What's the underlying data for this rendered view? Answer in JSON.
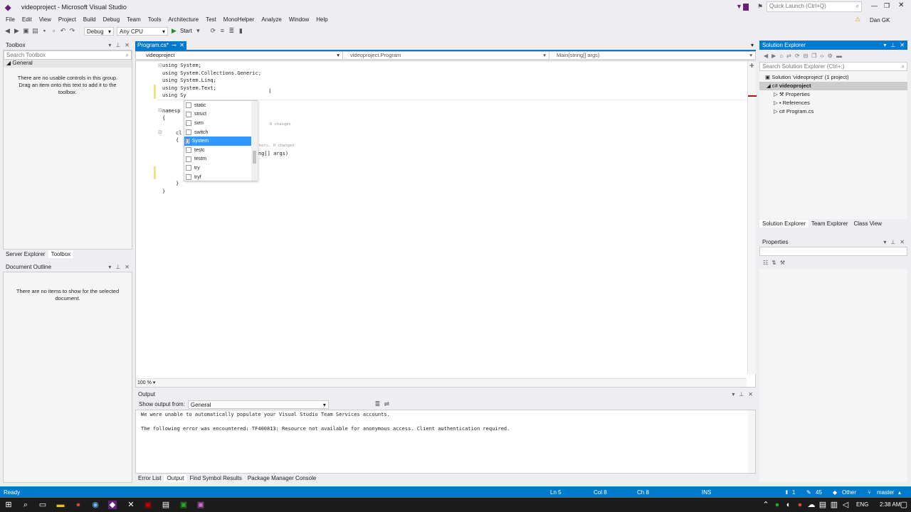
{
  "window": {
    "title": "videoproject - Microsoft Visual Studio",
    "quick_launch": "Quick Launch (Ctrl+Q)",
    "user": "Dan GK"
  },
  "menu": [
    "File",
    "Edit",
    "View",
    "Project",
    "Build",
    "Debug",
    "Team",
    "Tools",
    "Architecture",
    "Test",
    "MonoHelper",
    "Analyze",
    "Window",
    "Help"
  ],
  "toolbar": {
    "config": "Debug",
    "platform": "Any CPU",
    "start": "Start"
  },
  "toolbox": {
    "title": "Toolbox",
    "search": "Search Toolbox",
    "group": "General",
    "empty_msg": "There are no usable controls in this group. Drag an item onto this text to add it to the toolbox.",
    "tabs": [
      "Server Explorer",
      "Toolbox"
    ]
  },
  "outline": {
    "title": "Document Outline",
    "empty_msg": "There are no items to show for the selected document."
  },
  "editor": {
    "tab": "Program.cs*",
    "nav": [
      "videoproject",
      "videoproject.Program",
      "Main(string[] args)"
    ],
    "zoom": "100 %",
    "lines": [
      "using System;",
      "using System.Collections.Generic;",
      "using System.Linq;",
      "using System.Text;",
      "using Sy"
    ],
    "partial": [
      "namesp",
      "{",
      "cl",
      "{",
      "ng[] args)",
      "}",
      "}"
    ],
    "hints": [
      "0 changes",
      "hors, 0 changes"
    ]
  },
  "intellisense": {
    "items": [
      "static",
      "struct",
      "svm",
      "switch",
      "System",
      "testc",
      "testm",
      "try",
      "tryf"
    ],
    "selected_index": 4
  },
  "solution_explorer": {
    "title": "Solution Explorer",
    "search": "Search Solution Explorer (Ctrl+;)",
    "solution": "Solution 'videoproject' (1 project)",
    "project": "videoproject",
    "children": [
      "Properties",
      "References",
      "Program.cs"
    ],
    "tabs": [
      "Solution Explorer",
      "Team Explorer",
      "Class View"
    ]
  },
  "properties": {
    "title": "Properties"
  },
  "output": {
    "title": "Output",
    "show_from_label": "Show output from:",
    "source": "General",
    "lines": [
      "We were unable to automatically populate your Visual Studio Team Services accounts.",
      "",
      "The following error was encountered: TF400813: Resource not available for anonymous access. Client authentication required."
    ],
    "tabs": [
      "Error List",
      "Output",
      "Find Symbol Results",
      "Package Manager Console"
    ]
  },
  "status": {
    "ready": "Ready",
    "ln": "Ln 5",
    "col": "Col 8",
    "ch": "Ch 8",
    "ins": "INS",
    "up": "1",
    "edits": "45",
    "branch_ctx": "Other",
    "branch": "master"
  },
  "taskbar": {
    "lang": "ENG",
    "time": "2:38 AM"
  }
}
